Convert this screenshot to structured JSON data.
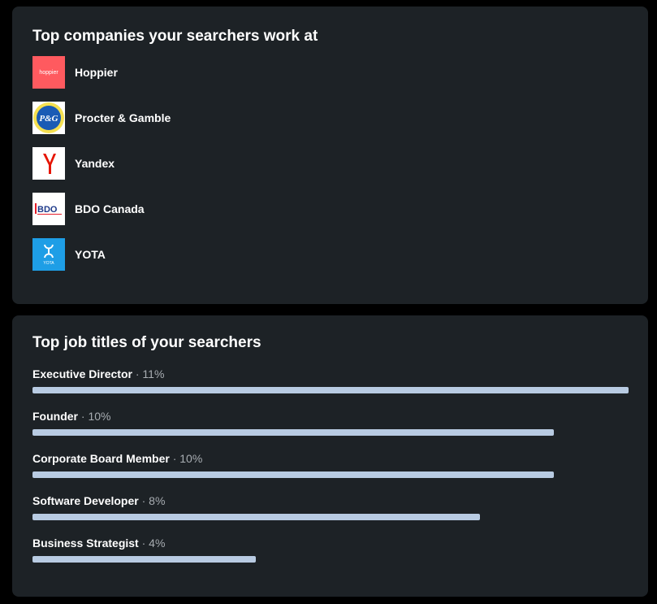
{
  "companies_card": {
    "title": "Top companies your searchers work at",
    "companies": [
      {
        "name": "Hoppier",
        "logo_text": "hoppier",
        "logo_icon": "hoppier-logo",
        "logo_color": "#ff5a5f"
      },
      {
        "name": "Procter & Gamble",
        "logo_text": "P&G",
        "logo_icon": "pg-logo",
        "logo_color": "#1a5bb5"
      },
      {
        "name": "Yandex",
        "logo_text": "Y",
        "logo_icon": "yandex-logo",
        "logo_color": "#e61400"
      },
      {
        "name": "BDO Canada",
        "logo_text": "BDO",
        "logo_icon": "bdo-logo",
        "logo_color": "#1e3a8a"
      },
      {
        "name": "YOTA",
        "logo_text": "YOTA",
        "logo_icon": "yota-logo",
        "logo_color": "#1e9ee6"
      }
    ]
  },
  "titles_card": {
    "title": "Top job titles of your searchers",
    "separator": " · ",
    "bar_color": "#b8cbe2",
    "jobs": [
      {
        "title": "Executive Director",
        "percent_label": "11%",
        "fill": 1.0
      },
      {
        "title": "Founder",
        "percent_label": "10%",
        "fill": 0.875
      },
      {
        "title": "Corporate Board Member",
        "percent_label": "10%",
        "fill": 0.875
      },
      {
        "title": "Software Developer",
        "percent_label": "8%",
        "fill": 0.75
      },
      {
        "title": "Business Strategist",
        "percent_label": "4%",
        "fill": 0.375
      }
    ]
  }
}
